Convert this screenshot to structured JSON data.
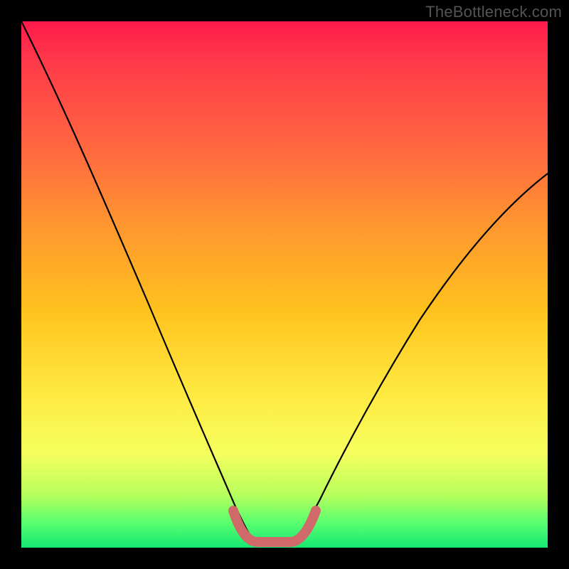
{
  "watermark": "TheBottleneck.com",
  "colors": {
    "background": "#000000",
    "gradient_top": "#ff1a4b",
    "gradient_mid": "#ffe83f",
    "gradient_bottom": "#16e873",
    "curve": "#000000",
    "flat_marker": "#d06a6a"
  },
  "chart_data": {
    "type": "line",
    "title": "",
    "xlabel": "",
    "ylabel": "",
    "xlim": [
      0,
      100
    ],
    "ylim": [
      0,
      100
    ],
    "grid": false,
    "series": [
      {
        "name": "bottleneck-curve",
        "x": [
          0,
          5,
          10,
          15,
          20,
          25,
          30,
          35,
          40,
          42,
          44,
          46,
          48,
          50,
          52,
          55,
          60,
          65,
          70,
          75,
          80,
          85,
          90,
          95,
          100
        ],
        "y": [
          100,
          90,
          80,
          70,
          60,
          49,
          38,
          27,
          14,
          8,
          2,
          0,
          0,
          0,
          2,
          7,
          16,
          25,
          33,
          41,
          48,
          54,
          60,
          66,
          71
        ]
      }
    ],
    "annotations": [
      {
        "name": "flat-bottom-marker",
        "x_range": [
          41,
          54
        ],
        "y": 2,
        "color": "#d06a6a"
      }
    ]
  }
}
